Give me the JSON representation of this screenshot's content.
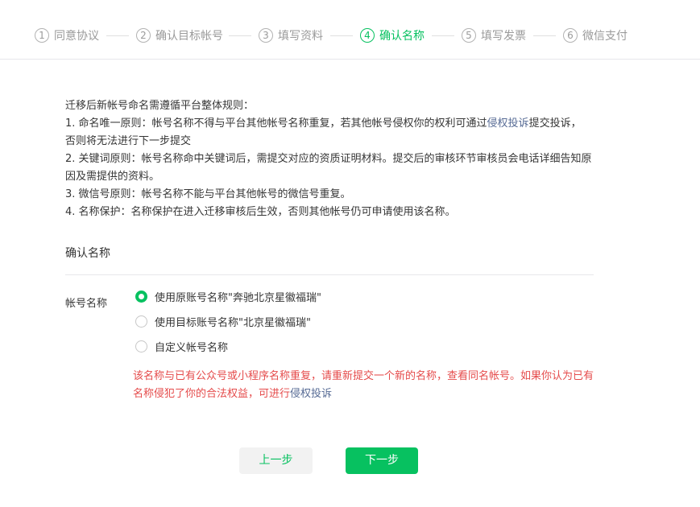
{
  "stepper": {
    "steps": [
      {
        "num": "1",
        "label": "同意协议",
        "state": "inactive"
      },
      {
        "num": "2",
        "label": "确认目标帐号",
        "state": "inactive"
      },
      {
        "num": "3",
        "label": "填写资料",
        "state": "inactive"
      },
      {
        "num": "4",
        "label": "确认名称",
        "state": "active"
      },
      {
        "num": "5",
        "label": "填写发票",
        "state": "inactive"
      },
      {
        "num": "6",
        "label": "微信支付",
        "state": "inactive"
      }
    ]
  },
  "rules": {
    "intro": "迁移后新帐号命名需遵循平台整体规则：",
    "rule1_before": "1. 命名唯一原则：帐号名称不得与平台其他帐号名称重复，若其他帐号侵权你的权利可通过",
    "rule1_link": "侵权投诉",
    "rule1_after": "提交投诉，",
    "rule1_line2": "否则将无法进行下一步提交",
    "rule2": "2. 关键词原则：帐号名称命中关键词后，需提交对应的资质证明材料。提交后的审核环节审核员会电话详细告知原因及需提供的资料。",
    "rule3": "3. 微信号原则：帐号名称不能与平台其他帐号的微信号重复。",
    "rule4": "4. 名称保护：名称保护在进入迁移审核后生效，否则其他帐号仍可申请使用该名称。"
  },
  "confirm": {
    "section_title": "确认名称",
    "field_label": "帐号名称",
    "options": [
      {
        "label": "使用原账号名称\"奔驰北京星徽福瑞\"",
        "checked": true
      },
      {
        "label": "使用目标账号名称\"北京星徽福瑞\"",
        "checked": false
      },
      {
        "label": "自定义帐号名称",
        "checked": false
      }
    ],
    "warning_text": "该名称与已有公众号或小程序名称重复，请重新提交一个新的名称，查看同名帐号。如果你认为已有名称侵犯了你的合法权益，可进行",
    "warning_link": "侵权投诉"
  },
  "buttons": {
    "prev": "上一步",
    "next": "下一步"
  },
  "colors": {
    "accent": "#07c160",
    "warning": "#e54b4b",
    "link": "#576b95"
  }
}
